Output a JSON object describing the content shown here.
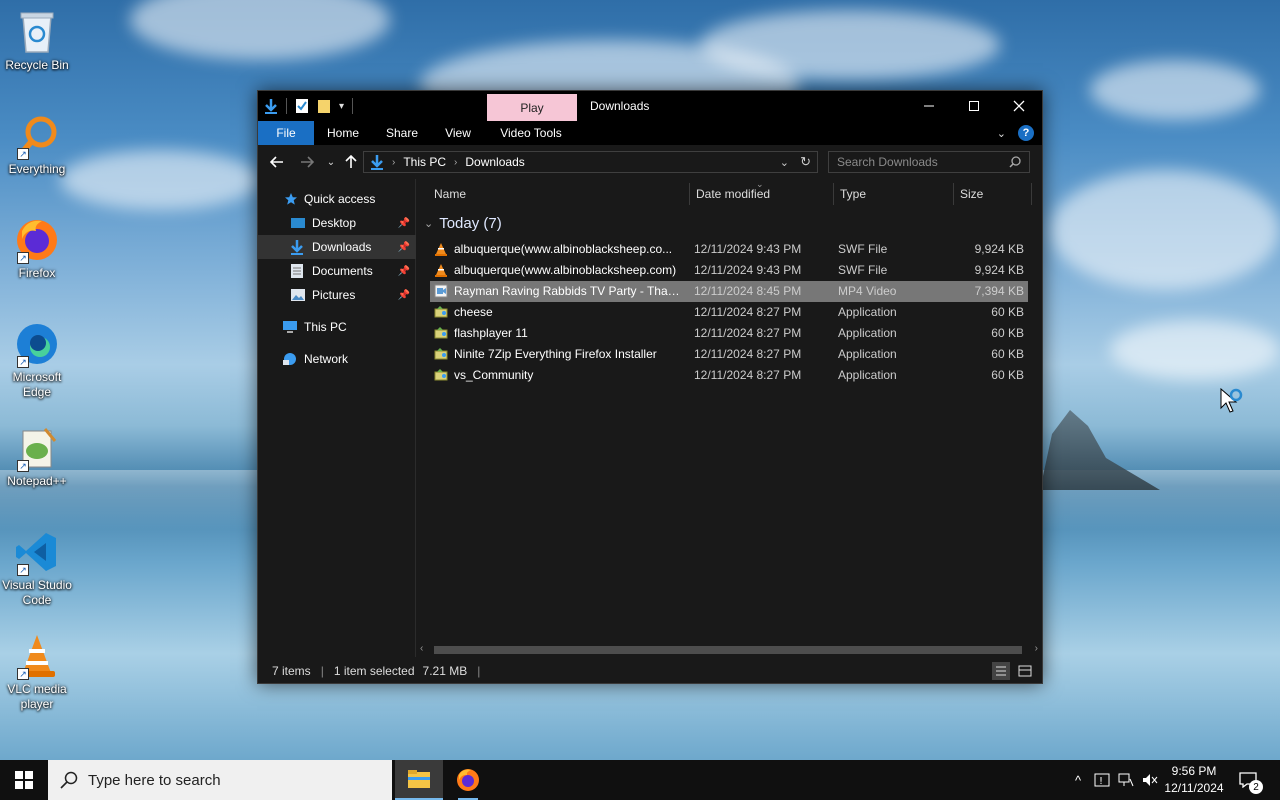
{
  "desktop": {
    "icons": [
      {
        "label": "Recycle Bin"
      },
      {
        "label": "Everything"
      },
      {
        "label": "Firefox"
      },
      {
        "label": "Microsoft Edge"
      },
      {
        "label": "Notepad++"
      },
      {
        "label": "Visual Studio Code"
      },
      {
        "label": "VLC media player"
      }
    ]
  },
  "window": {
    "title": "Downloads",
    "context_tab": "Play",
    "ribbon_tabs": [
      "File",
      "Home",
      "Share",
      "View",
      "Video Tools"
    ],
    "help": "?",
    "breadcrumb": [
      "This PC",
      "Downloads"
    ],
    "search_placeholder": "Search Downloads",
    "nav": {
      "quick_access": "Quick access",
      "pinned": [
        "Desktop",
        "Downloads",
        "Documents",
        "Pictures"
      ],
      "this_pc": "This PC",
      "network": "Network"
    },
    "columns": [
      "Name",
      "Date modified",
      "Type",
      "Size"
    ],
    "group": "Today (7)",
    "files": [
      {
        "name": "albuquerque(www.albinoblacksheep.co...",
        "date": "12/11/2024 9:43 PM",
        "type": "SWF File",
        "size": "9,924 KB",
        "icon": "vlc-cone-icon"
      },
      {
        "name": "albuquerque(www.albinoblacksheep.com)",
        "date": "12/11/2024 9:43 PM",
        "type": "SWF File",
        "size": "9,924 KB",
        "icon": "vlc-cone-icon"
      },
      {
        "name": "Rayman Raving Rabbids TV Party - Thank...",
        "date": "12/11/2024 8:45 PM",
        "type": "MP4 Video",
        "size": "7,394 KB",
        "icon": "video-file-icon"
      },
      {
        "name": "cheese",
        "date": "12/11/2024 8:27 PM",
        "type": "Application",
        "size": "60 KB",
        "icon": "installer-icon"
      },
      {
        "name": "flashplayer 11",
        "date": "12/11/2024 8:27 PM",
        "type": "Application",
        "size": "60 KB",
        "icon": "installer-icon"
      },
      {
        "name": "Ninite 7Zip Everything Firefox Installer",
        "date": "12/11/2024 8:27 PM",
        "type": "Application",
        "size": "60 KB",
        "icon": "installer-icon"
      },
      {
        "name": "vs_Community",
        "date": "12/11/2024 8:27 PM",
        "type": "Application",
        "size": "60 KB",
        "icon": "installer-icon"
      }
    ],
    "selected_index": 2,
    "status": {
      "items": "7 items",
      "selection": "1 item selected",
      "size": "7.21 MB"
    }
  },
  "taskbar": {
    "search_placeholder": "Type here to search",
    "time": "9:56 PM",
    "date": "12/11/2024",
    "notification_count": "2"
  },
  "colors": {
    "accent": "#1a6fc4",
    "context_tab": "#f6c6d6",
    "selection": "#777777"
  }
}
